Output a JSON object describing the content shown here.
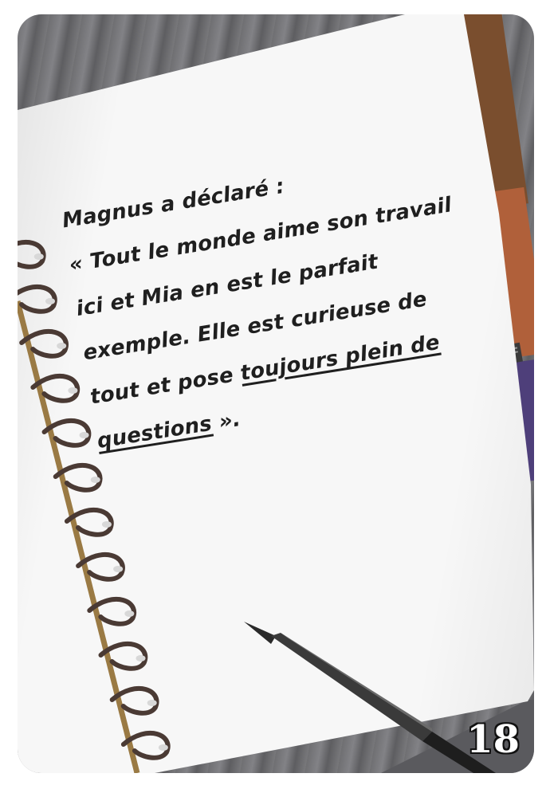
{
  "note": {
    "lines": [
      "Magnus a déclaré :",
      "« Tout le monde aime son travail",
      "ici et Mia en est le parfait",
      "exemple. Elle est curieuse de"
    ],
    "line5_prefix": "tout et pose ",
    "line5_underlined": "toujours plein de",
    "line6_underlined": "questions",
    "line6_suffix": " »."
  },
  "card_number": "18",
  "icons": {
    "tab_icon_1": "person-icon",
    "tab_icon_2": "book-icon"
  },
  "colors": {
    "tab_yellow": "#d5e62a",
    "tab_brown": "#7a4e2e",
    "tab_orange": "#b0603a",
    "tab_purple": "#4e3f7a",
    "paper": "#f7f7f7",
    "ink": "#1f1f1f"
  }
}
